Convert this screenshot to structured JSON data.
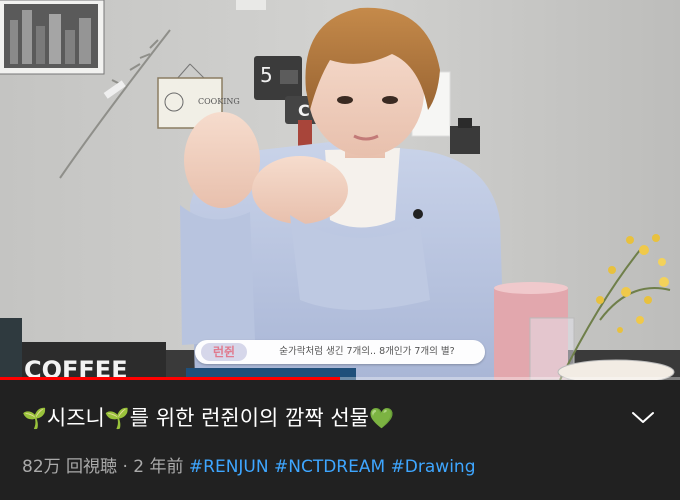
{
  "video": {
    "progress_fraction": 0.5,
    "caption": {
      "speaker": "런쥔",
      "text": "숟가락처럼 생긴 7개의.. 8개인가 7개의 별?"
    },
    "scene": {
      "sign_cooking": "COOKING",
      "sign_coffee": "COFFEE",
      "sign_coffee_small": "C",
      "sign_number": "5"
    }
  },
  "info": {
    "title_prefix_emoji": "🌱",
    "title_part1": "시즈니",
    "title_mid_emoji": "🌱",
    "title_part2": "를 위한 런쥔이의 깜짝 선물",
    "title_suffix_emoji": "💚",
    "views": "82万 回視聴",
    "separator": "·",
    "age": "2 年前",
    "hashtags": [
      "#RENJUN",
      "#NCTDREAM",
      "#Drawing"
    ]
  },
  "colors": {
    "background": "#212121",
    "progress": "#ff0000",
    "hashtag": "#3ea6ff",
    "meta": "#aaaaaa",
    "title": "#ffffff"
  },
  "icons": {
    "expand": "chevron-down-icon"
  }
}
